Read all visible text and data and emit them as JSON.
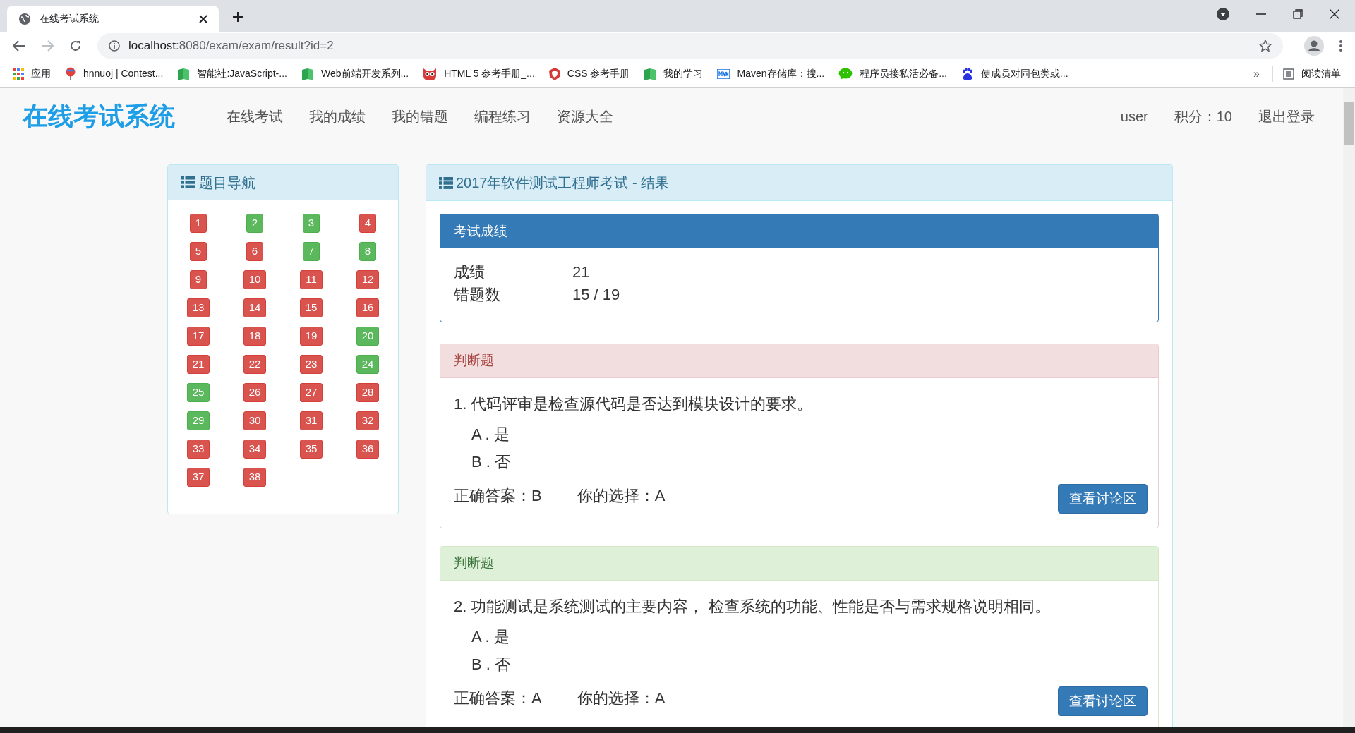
{
  "browser": {
    "tab_title": "在线考试系统",
    "url_host": "localhost",
    "url_path": ":8080/exam/exam/result?id=2",
    "bookmarks": [
      {
        "kind": "apps",
        "label": "应用"
      },
      {
        "kind": "balloon",
        "label": "hnnuoj | Contest..."
      },
      {
        "kind": "book",
        "label": "智能社:JavaScript-..."
      },
      {
        "kind": "book",
        "label": "Web前端开发系列..."
      },
      {
        "kind": "owl",
        "label": "HTML 5 参考手册_..."
      },
      {
        "kind": "shield",
        "label": "CSS 参考手册"
      },
      {
        "kind": "book",
        "label": "我的学习"
      },
      {
        "kind": "mvn",
        "label": "Maven存储库：搜..."
      },
      {
        "kind": "chat",
        "label": "程序员接私活必备..."
      },
      {
        "kind": "paw",
        "label": "使成员对同包类或..."
      }
    ],
    "overflow": "»",
    "reading_list": "阅读清单"
  },
  "navbar": {
    "logo": "在线考试系统",
    "menu": [
      "在线考试",
      "我的成绩",
      "我的错题",
      "编程练习",
      "资源大全"
    ],
    "user": "user",
    "points": "积分：10",
    "logout": "退出登录"
  },
  "sidebar": {
    "title": "题目导航",
    "questions": [
      {
        "number": "1",
        "correct": false
      },
      {
        "number": "2",
        "correct": true
      },
      {
        "number": "3",
        "correct": true
      },
      {
        "number": "4",
        "correct": false
      },
      {
        "number": "5",
        "correct": false
      },
      {
        "number": "6",
        "correct": false
      },
      {
        "number": "7",
        "correct": true
      },
      {
        "number": "8",
        "correct": true
      },
      {
        "number": "9",
        "correct": false
      },
      {
        "number": "10",
        "correct": false
      },
      {
        "number": "11",
        "correct": false
      },
      {
        "number": "12",
        "correct": false
      },
      {
        "number": "13",
        "correct": false
      },
      {
        "number": "14",
        "correct": false
      },
      {
        "number": "15",
        "correct": false
      },
      {
        "number": "16",
        "correct": false
      },
      {
        "number": "17",
        "correct": false
      },
      {
        "number": "18",
        "correct": false
      },
      {
        "number": "19",
        "correct": false
      },
      {
        "number": "20",
        "correct": true
      },
      {
        "number": "21",
        "correct": false
      },
      {
        "number": "22",
        "correct": false
      },
      {
        "number": "23",
        "correct": false
      },
      {
        "number": "24",
        "correct": true
      },
      {
        "number": "25",
        "correct": true
      },
      {
        "number": "26",
        "correct": false
      },
      {
        "number": "27",
        "correct": false
      },
      {
        "number": "28",
        "correct": false
      },
      {
        "number": "29",
        "correct": true
      },
      {
        "number": "30",
        "correct": false
      },
      {
        "number": "31",
        "correct": false
      },
      {
        "number": "32",
        "correct": false
      },
      {
        "number": "33",
        "correct": false
      },
      {
        "number": "34",
        "correct": false
      },
      {
        "number": "35",
        "correct": false
      },
      {
        "number": "36",
        "correct": false
      },
      {
        "number": "37",
        "correct": false
      },
      {
        "number": "38",
        "correct": false
      }
    ]
  },
  "result": {
    "title": "2017年软件测试工程师考试 - 结果",
    "score_card": {
      "title": "考试成绩",
      "rows": [
        {
          "label": "成绩",
          "value": "21"
        },
        {
          "label": "错题数",
          "value": "15 / 19"
        }
      ]
    },
    "questions": [
      {
        "type": "判断题",
        "correct": false,
        "text": "1. 代码评审是检查源代码是否达到模块设计的要求。",
        "options": [
          "A . 是",
          "B . 否"
        ],
        "answer": "正确答案：B",
        "choice": "你的选择：A",
        "button": "查看讨论区"
      },
      {
        "type": "判断题",
        "correct": true,
        "text": "2. 功能测试是系统测试的主要内容， 检查系统的功能、性能是否与需求规格说明相同。",
        "options": [
          "A . 是",
          "B . 否"
        ],
        "answer": "正确答案：A",
        "choice": "你的选择：A",
        "button": "查看讨论区"
      }
    ]
  }
}
